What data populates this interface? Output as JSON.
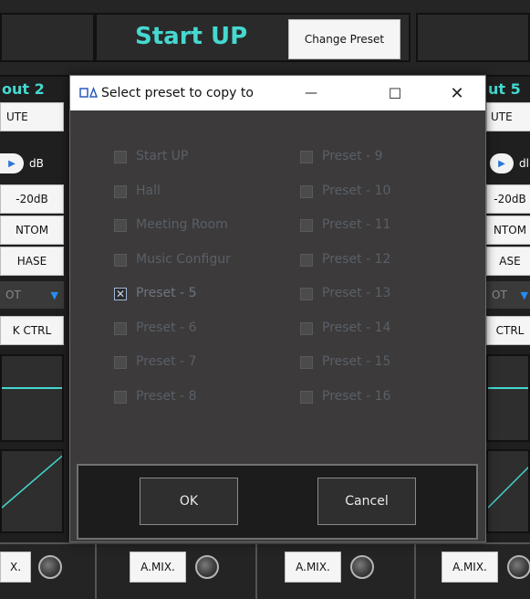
{
  "header": {
    "title": "Start UP",
    "change_preset_label": "Change Preset"
  },
  "channels": {
    "left_label": "out 2",
    "right_label": "ut 5",
    "left": {
      "mute": "UTE",
      "db_unit": "dB",
      "pad": "-20dB",
      "phantom": "NTOM",
      "phase": "HASE",
      "dropdown": "OT",
      "ctrl": "K CTRL"
    },
    "right": {
      "mute": "UTE",
      "db_unit": "dl",
      "pad": "-20dB",
      "phantom": "NTOM",
      "phase": "ASE",
      "dropdown": "OT",
      "ctrl": "CTRL"
    }
  },
  "bottom_bar": {
    "amix_partial": "X.",
    "amix": [
      "A.MIX.",
      "A.MIX.",
      "A.MIX."
    ]
  },
  "dialog": {
    "title": "Select preset to copy to",
    "minimize": "—",
    "maximize": "☐",
    "close": "✕",
    "left_items": [
      {
        "label": "Start UP",
        "checked": false
      },
      {
        "label": "Hall",
        "checked": false
      },
      {
        "label": "Meeting Room",
        "checked": false
      },
      {
        "label": "Music Configur",
        "checked": false
      },
      {
        "label": "Preset - 5",
        "checked": true
      },
      {
        "label": "Preset - 6",
        "checked": false
      },
      {
        "label": "Preset - 7",
        "checked": false
      },
      {
        "label": "Preset - 8",
        "checked": false
      }
    ],
    "right_items": [
      {
        "label": "Preset - 9",
        "checked": false
      },
      {
        "label": "Preset - 10",
        "checked": false
      },
      {
        "label": "Preset - 11",
        "checked": false
      },
      {
        "label": "Preset - 12",
        "checked": false
      },
      {
        "label": "Preset - 13",
        "checked": false
      },
      {
        "label": "Preset - 14",
        "checked": false
      },
      {
        "label": "Preset - 15",
        "checked": false
      },
      {
        "label": "Preset - 16",
        "checked": false
      }
    ],
    "ok_label": "OK",
    "cancel_label": "Cancel"
  },
  "colors": {
    "accent": "#45d8d0",
    "background": "#2b2b2b",
    "dialog_bg": "#3c3a3a"
  }
}
